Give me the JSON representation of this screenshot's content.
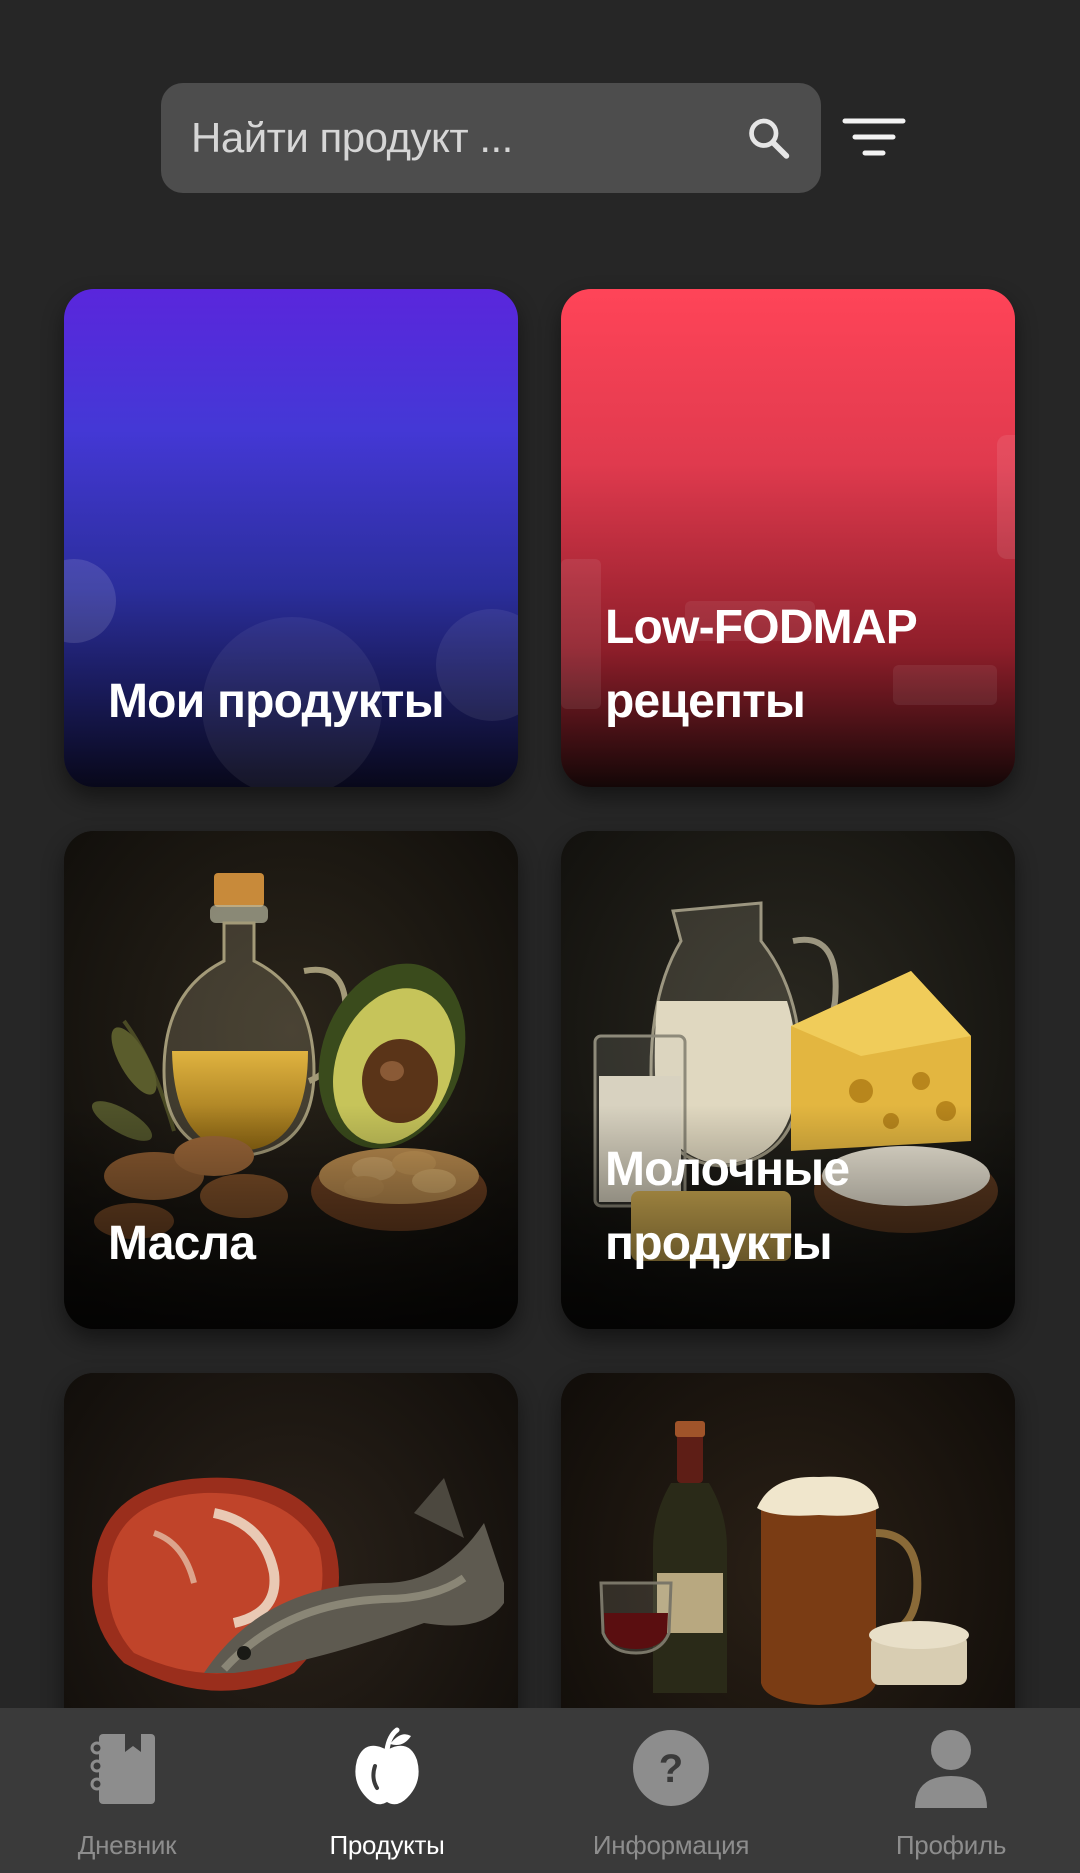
{
  "search": {
    "placeholder": "Найти продукт ...",
    "value": ""
  },
  "categories": [
    {
      "id": "my-products",
      "label": "Мои продукты"
    },
    {
      "id": "low-fodmap",
      "label": "Low-FODMAP\nрецепты"
    },
    {
      "id": "oils",
      "label": "Масла"
    },
    {
      "id": "dairy",
      "label": "Молочные\nпродукты"
    },
    {
      "id": "meat-fish",
      "label": ""
    },
    {
      "id": "drinks",
      "label": ""
    }
  ],
  "nav": {
    "items": [
      {
        "label": "Дневник",
        "icon": "notebook-icon",
        "active": false
      },
      {
        "label": "Продукты",
        "icon": "apple-icon",
        "active": true
      },
      {
        "label": "Информация",
        "icon": "question-icon",
        "active": false
      },
      {
        "label": "Профиль",
        "icon": "person-icon",
        "active": false
      }
    ]
  },
  "colors": {
    "background": "#262626",
    "nav_background": "#3a3a3a",
    "search_background": "#4d4d4d",
    "nav_inactive": "#8d8d8d",
    "nav_active": "#ffffff"
  }
}
